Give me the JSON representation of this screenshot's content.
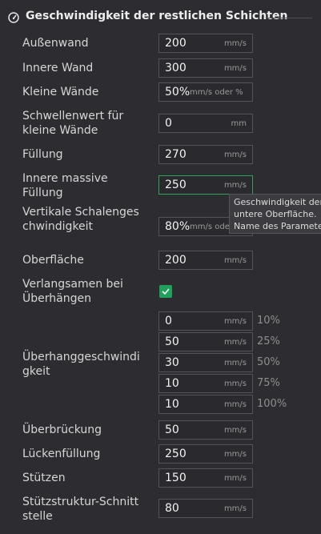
{
  "header": {
    "title": "Geschwindigkeit der restlichen Schichten",
    "icon": "speedometer-icon"
  },
  "rows": [
    {
      "label": "Außenwand",
      "value": "200",
      "unit": "mm/s"
    },
    {
      "label": "Innere Wand",
      "value": "300",
      "unit": "mm/s"
    },
    {
      "label": "Kleine Wände",
      "value": "50%",
      "unit": "mm/s oder %"
    },
    {
      "label": "Schwellenwert für kleine Wände",
      "value": "0",
      "unit": "mm"
    },
    {
      "label": "Füllung",
      "value": "270",
      "unit": "mm/s"
    },
    {
      "label": "Innere massive Füllung",
      "value": "250",
      "unit": "mm/s"
    },
    {
      "label": "Vertikale Schalengeschwindigkeit",
      "value": "80%",
      "unit": "mm/s oder %"
    },
    {
      "label": "Oberfläche",
      "value": "200",
      "unit": "mm/s"
    }
  ],
  "slow_overhang": {
    "label": "Verlangsamen bei Überhängen",
    "checked": true
  },
  "overhang": {
    "label": "Überhanggeschwindigkeit",
    "speeds": [
      {
        "value": "0",
        "unit": "mm/s",
        "pct": "10%"
      },
      {
        "value": "50",
        "unit": "mm/s",
        "pct": "25%"
      },
      {
        "value": "30",
        "unit": "mm/s",
        "pct": "50%"
      },
      {
        "value": "10",
        "unit": "mm/s",
        "pct": "75%"
      },
      {
        "value": "10",
        "unit": "mm/s",
        "pct": "100%"
      }
    ]
  },
  "rows2": [
    {
      "label": "Überbrückung",
      "value": "50",
      "unit": "mm/s"
    },
    {
      "label": "Lückenfüllung",
      "value": "250",
      "unit": "mm/s"
    },
    {
      "label": "Stützen",
      "value": "150",
      "unit": "mm/s"
    },
    {
      "label": "Stützstruktur-Schnittstelle",
      "value": "80",
      "unit": "mm/s"
    }
  ],
  "tooltip": {
    "line1": "Geschwindigkeit der",
    "line2": "untere Oberfläche.",
    "line3": "Name des Parameter"
  }
}
